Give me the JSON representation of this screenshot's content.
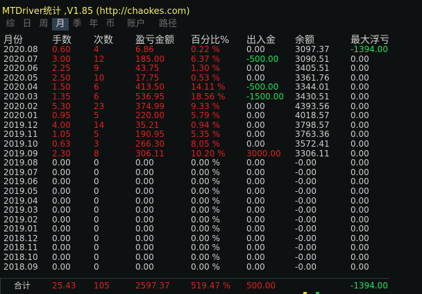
{
  "title": "MTDriver统计 ,V1.85 (http://chaokes.com)",
  "tabs": [
    {
      "label": "综",
      "active": false
    },
    {
      "label": "日",
      "active": false
    },
    {
      "label": "周",
      "active": false
    },
    {
      "label": "月",
      "active": true
    },
    {
      "label": "季",
      "active": false
    },
    {
      "label": "年",
      "active": false
    },
    {
      "label": "币",
      "active": false
    },
    {
      "label": "账户",
      "active": false
    },
    {
      "label": "路径",
      "active": false
    }
  ],
  "headers": {
    "month": "月份",
    "lots": "手数",
    "trades": "次数",
    "pnl": "盈亏金额",
    "pct": "百分比%",
    "io": "出入金",
    "balance": "余额",
    "dd": "最大浮亏"
  },
  "rows": [
    {
      "month": "2020.08",
      "lots": "0.60",
      "trades": "4",
      "pnl": "6.86",
      "pct": "0.22 %",
      "io": "0.00",
      "balance": "3097.37",
      "dd": "-1394.00",
      "c": [
        "red",
        "red",
        "red",
        "red",
        "grey",
        "grey",
        "green"
      ]
    },
    {
      "month": "2020.07",
      "lots": "3.00",
      "trades": "12",
      "pnl": "185.00",
      "pct": "6.37 %",
      "io": "-500.00",
      "balance": "3090.51",
      "dd": "0.00",
      "c": [
        "red",
        "red",
        "red",
        "red",
        "green",
        "grey",
        "grey"
      ]
    },
    {
      "month": "2020.06",
      "lots": "2.25",
      "trades": "9",
      "pnl": "43.75",
      "pct": "1.30 %",
      "io": "0.00",
      "balance": "3405.51",
      "dd": "0.00",
      "c": [
        "red",
        "red",
        "red",
        "red",
        "grey",
        "grey",
        "grey"
      ]
    },
    {
      "month": "2020.05",
      "lots": "2.50",
      "trades": "10",
      "pnl": "17.75",
      "pct": "0.53 %",
      "io": "0.00",
      "balance": "3361.76",
      "dd": "0.00",
      "c": [
        "red",
        "red",
        "red",
        "red",
        "grey",
        "grey",
        "grey"
      ]
    },
    {
      "month": "2020.04",
      "lots": "1.50",
      "trades": "6",
      "pnl": "413.50",
      "pct": "14.11 %",
      "io": "-500.00",
      "balance": "3344.01",
      "dd": "0.00",
      "c": [
        "red",
        "red",
        "red",
        "red",
        "green",
        "grey",
        "grey"
      ]
    },
    {
      "month": "2020.03",
      "lots": "1.35",
      "trades": "6",
      "pnl": "536.95",
      "pct": "18.56 %",
      "io": "-1500.00",
      "balance": "3430.51",
      "dd": "0.00",
      "c": [
        "red",
        "red",
        "red",
        "red",
        "green",
        "grey",
        "grey"
      ]
    },
    {
      "month": "2020.02",
      "lots": "5.30",
      "trades": "23",
      "pnl": "374.99",
      "pct": "9.33 %",
      "io": "0.00",
      "balance": "4393.56",
      "dd": "0.00",
      "c": [
        "red",
        "red",
        "red",
        "red",
        "grey",
        "grey",
        "grey"
      ]
    },
    {
      "month": "2020.01",
      "lots": "0.95",
      "trades": "5",
      "pnl": "220.00",
      "pct": "5.79 %",
      "io": "0.00",
      "balance": "4018.57",
      "dd": "0.00",
      "c": [
        "red",
        "red",
        "red",
        "red",
        "grey",
        "grey",
        "grey"
      ]
    },
    {
      "month": "2019.12",
      "lots": "4.00",
      "trades": "14",
      "pnl": "35.21",
      "pct": "0.94 %",
      "io": "0.00",
      "balance": "3798.57",
      "dd": "0.00",
      "c": [
        "red",
        "red",
        "red",
        "red",
        "grey",
        "grey",
        "grey"
      ]
    },
    {
      "month": "2019.11",
      "lots": "1.05",
      "trades": "5",
      "pnl": "190.95",
      "pct": "5.35 %",
      "io": "0.00",
      "balance": "3763.36",
      "dd": "0.00",
      "c": [
        "red",
        "red",
        "red",
        "red",
        "grey",
        "grey",
        "grey"
      ]
    },
    {
      "month": "2019.10",
      "lots": "0.63",
      "trades": "3",
      "pnl": "266.30",
      "pct": "8.05 %",
      "io": "0.00",
      "balance": "3572.41",
      "dd": "0.00",
      "c": [
        "red",
        "red",
        "red",
        "red",
        "grey",
        "grey",
        "grey"
      ]
    },
    {
      "month": "2019.09",
      "lots": "2.30",
      "trades": "8",
      "pnl": "306.11",
      "pct": "10.20 %",
      "io": "3000.00",
      "balance": "3306.11",
      "dd": "0.00",
      "c": [
        "red",
        "red",
        "red",
        "red",
        "red",
        "grey",
        "grey"
      ]
    },
    {
      "month": "2019.08",
      "lots": "0.00",
      "trades": "0",
      "pnl": "0.00",
      "pct": "0.00 %",
      "io": "0.00",
      "balance": "-0.00",
      "dd": "0.00",
      "c": [
        "grey",
        "grey",
        "grey",
        "grey",
        "grey",
        "grey",
        "grey"
      ]
    },
    {
      "month": "2019.07",
      "lots": "0.00",
      "trades": "0",
      "pnl": "0.00",
      "pct": "0.00 %",
      "io": "0.00",
      "balance": "-0.00",
      "dd": "0.00",
      "c": [
        "grey",
        "grey",
        "grey",
        "grey",
        "grey",
        "grey",
        "grey"
      ]
    },
    {
      "month": "2019.06",
      "lots": "0.00",
      "trades": "0",
      "pnl": "0.00",
      "pct": "0.00 %",
      "io": "0.00",
      "balance": "-0.00",
      "dd": "0.00",
      "c": [
        "grey",
        "grey",
        "grey",
        "grey",
        "grey",
        "grey",
        "grey"
      ]
    },
    {
      "month": "2019.05",
      "lots": "0.00",
      "trades": "0",
      "pnl": "0.00",
      "pct": "0.00 %",
      "io": "0.00",
      "balance": "-0.00",
      "dd": "0.00",
      "c": [
        "grey",
        "grey",
        "grey",
        "grey",
        "grey",
        "grey",
        "grey"
      ]
    },
    {
      "month": "2019.04",
      "lots": "0.00",
      "trades": "0",
      "pnl": "0.00",
      "pct": "0.00 %",
      "io": "0.00",
      "balance": "-0.00",
      "dd": "0.00",
      "c": [
        "grey",
        "grey",
        "grey",
        "grey",
        "grey",
        "grey",
        "grey"
      ]
    },
    {
      "month": "2019.03",
      "lots": "0.00",
      "trades": "0",
      "pnl": "0.00",
      "pct": "0.00 %",
      "io": "0.00",
      "balance": "-0.00",
      "dd": "0.00",
      "c": [
        "grey",
        "grey",
        "grey",
        "grey",
        "grey",
        "grey",
        "grey"
      ]
    },
    {
      "month": "2019.02",
      "lots": "0.00",
      "trades": "0",
      "pnl": "0.00",
      "pct": "0.00 %",
      "io": "0.00",
      "balance": "-0.00",
      "dd": "0.00",
      "c": [
        "grey",
        "grey",
        "grey",
        "grey",
        "grey",
        "grey",
        "grey"
      ]
    },
    {
      "month": "2019.01",
      "lots": "0.00",
      "trades": "0",
      "pnl": "0.00",
      "pct": "0.00 %",
      "io": "0.00",
      "balance": "-0.00",
      "dd": "0.00",
      "c": [
        "grey",
        "grey",
        "grey",
        "grey",
        "grey",
        "grey",
        "grey"
      ]
    },
    {
      "month": "2018.12",
      "lots": "0.00",
      "trades": "0",
      "pnl": "0.00",
      "pct": "0.00 %",
      "io": "0.00",
      "balance": "-0.00",
      "dd": "0.00",
      "c": [
        "grey",
        "grey",
        "grey",
        "grey",
        "grey",
        "grey",
        "grey"
      ]
    },
    {
      "month": "2018.11",
      "lots": "0.00",
      "trades": "0",
      "pnl": "0.00",
      "pct": "0.00 %",
      "io": "0.00",
      "balance": "-0.00",
      "dd": "0.00",
      "c": [
        "grey",
        "grey",
        "grey",
        "grey",
        "grey",
        "grey",
        "grey"
      ]
    },
    {
      "month": "2018.10",
      "lots": "0.00",
      "trades": "0",
      "pnl": "0.00",
      "pct": "0.00 %",
      "io": "0.00",
      "balance": "-0.00",
      "dd": "0.00",
      "c": [
        "grey",
        "grey",
        "grey",
        "grey",
        "grey",
        "grey",
        "grey"
      ]
    },
    {
      "month": "2018.09",
      "lots": "0.00",
      "trades": "0",
      "pnl": "0.00",
      "pct": "0.00 %",
      "io": "0.00",
      "balance": "-0.00",
      "dd": "0.00",
      "c": [
        "grey",
        "grey",
        "grey",
        "grey",
        "grey",
        "grey",
        "grey"
      ]
    }
  ],
  "total": {
    "label": "合计",
    "lots": "25.43",
    "trades": "105",
    "pnl": "2597.37",
    "pct": "519.47 %",
    "io": "500.00",
    "dd": "-1394.00"
  },
  "colors": {
    "red": "#e32020",
    "grey": "#cdcdcd",
    "green": "#21e15a",
    "title": "#f3ec5e"
  }
}
